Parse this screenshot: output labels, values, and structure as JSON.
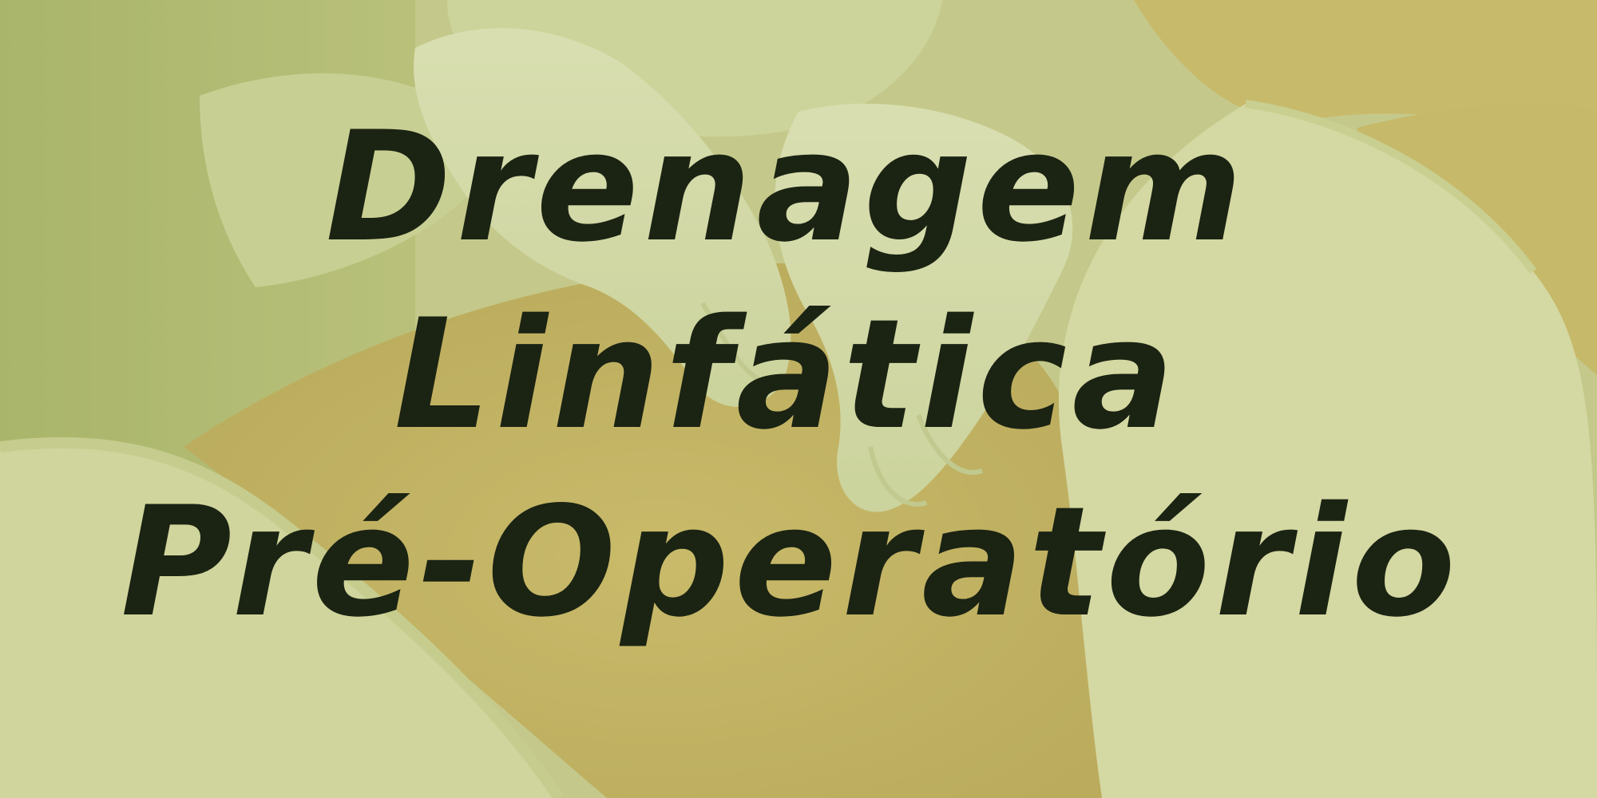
{
  "title": {
    "lines": [
      "Drenagem",
      "Linfática",
      "Pré-Operatório"
    ]
  },
  "colors": {
    "text": "#1b2313",
    "overlay_tint": "#c6cd8c"
  }
}
